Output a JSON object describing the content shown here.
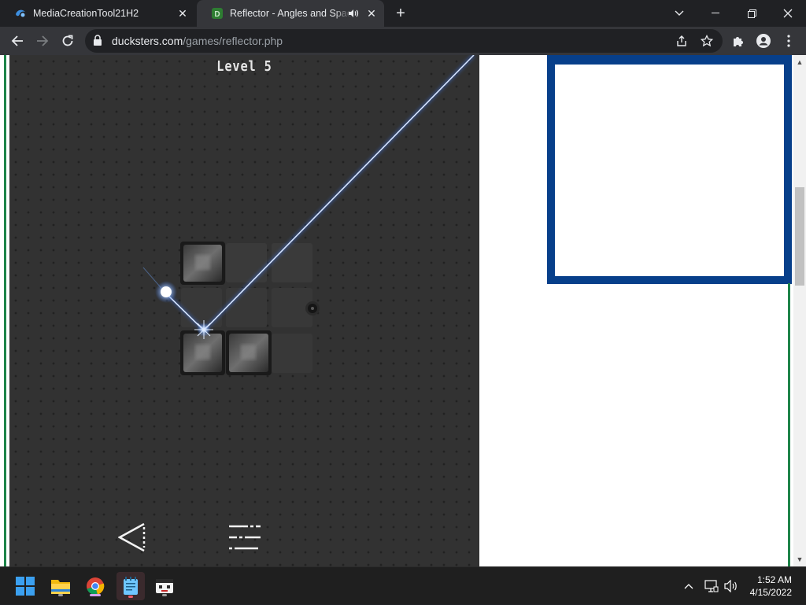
{
  "browser": {
    "tabs": [
      {
        "title": "MediaCreationTool21H2",
        "active": false
      },
      {
        "title": "Reflector - Angles and Spacing",
        "active": true,
        "audio": true
      }
    ],
    "new_tab_label": "+",
    "close_glyph": "✕",
    "address": {
      "host": "ducksters.com",
      "path": "/games/reflector.php"
    }
  },
  "game": {
    "level_label": "Level  5",
    "back_icon": "triangle-back-icon",
    "menu_icon": "menu-lines-icon"
  },
  "taskbar": {
    "apps": [
      "start-icon",
      "file-explorer-icon",
      "chrome-icon",
      "notepad-icon",
      "terminal-app-icon"
    ],
    "time": "1:52 AM",
    "date": "4/15/2022"
  },
  "colors": {
    "game_bg": "#323232",
    "ad_border": "#073f8a",
    "page_accent_green": "#1e8449",
    "laser": "#6fa8ff"
  }
}
